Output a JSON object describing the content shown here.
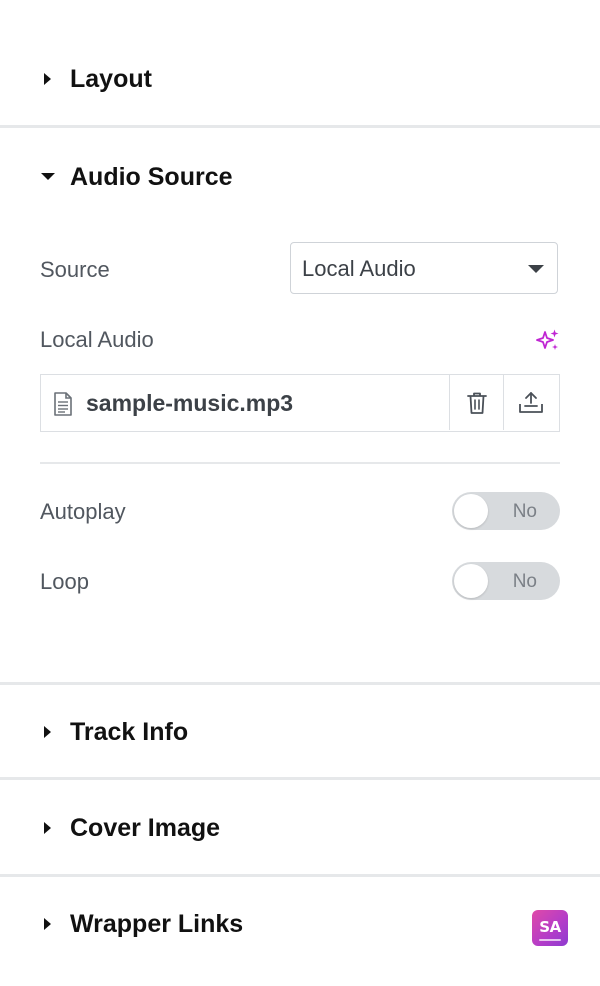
{
  "sections": {
    "layout": {
      "title": "Layout"
    },
    "audio_source": {
      "title": "Audio Source",
      "source": {
        "label": "Source",
        "value": "Local Audio"
      },
      "local_audio": {
        "label": "Local Audio",
        "file_name": "sample-music.mp3"
      },
      "autoplay": {
        "label": "Autoplay",
        "state": "No"
      },
      "loop": {
        "label": "Loop",
        "state": "No"
      }
    },
    "track_info": {
      "title": "Track Info"
    },
    "cover_image": {
      "title": "Cover Image"
    },
    "wrapper_links": {
      "title": "Wrapper Links"
    }
  },
  "icons": {
    "ai": "ai-sparkle-icon",
    "file": "file-icon",
    "delete": "trash-icon",
    "upload": "upload-icon",
    "brand": "brand-badge-icon"
  },
  "colors": {
    "ai_accent": "#c026d3",
    "brand_gradient_start": "#e04aa8",
    "brand_gradient_end": "#8d3bd0",
    "toggle_off": "#d7dadd"
  }
}
